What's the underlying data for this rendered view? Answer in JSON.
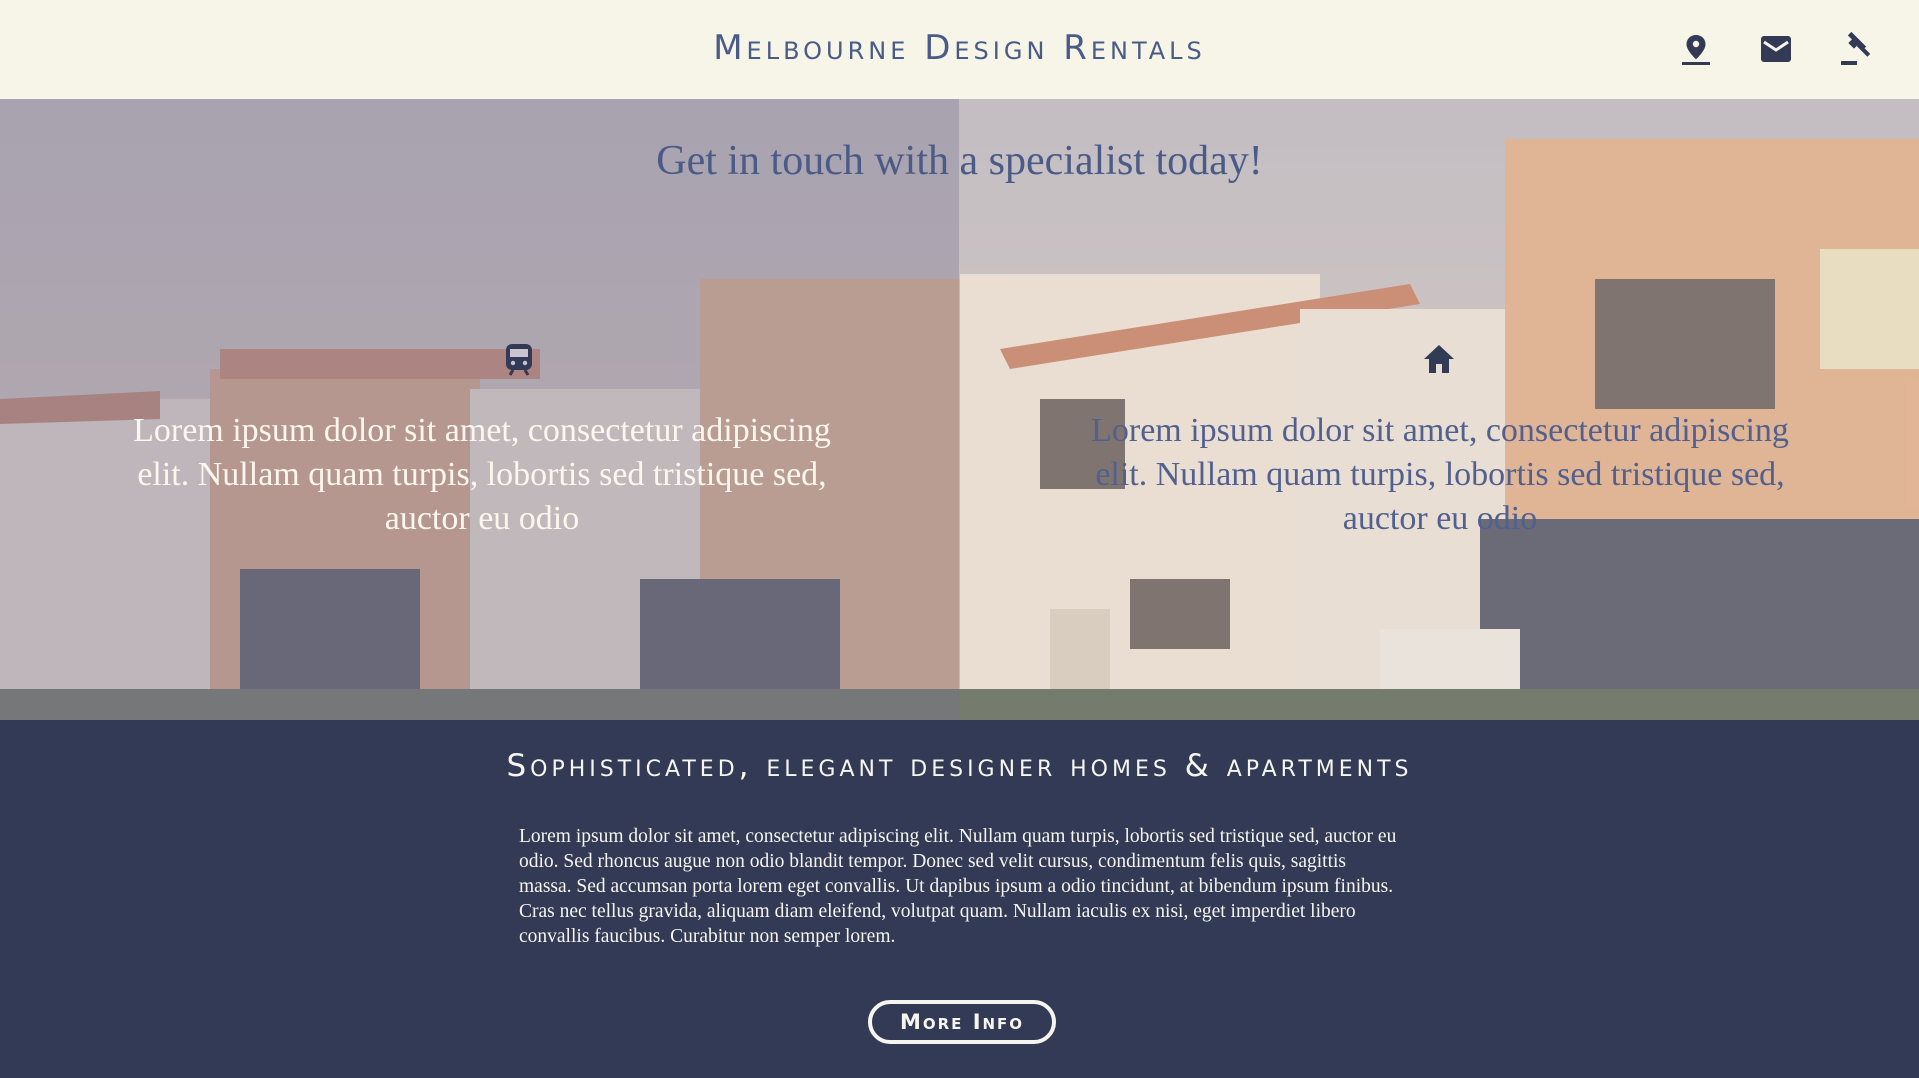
{
  "header": {
    "brand": "Melbourne Design Rentals",
    "icons": [
      "map-pin-icon",
      "mail-icon",
      "gavel-icon"
    ]
  },
  "hero": {
    "title": "Get in touch with a specialist today!",
    "columns": [
      {
        "icon": "train-icon",
        "text": "Lorem ipsum dolor sit amet, consectetur adipiscing elit. Nullam quam turpis, lobortis sed tristique sed, auctor eu odio"
      },
      {
        "icon": "home-icon",
        "text": "Lorem ipsum dolor sit amet, consectetur adipiscing elit. Nullam quam turpis, lobortis sed tristique sed, auctor eu odio"
      }
    ]
  },
  "info": {
    "title": "Sophisticated, elegant designer homes & apartments",
    "body": "Lorem ipsum dolor sit amet, consectetur adipiscing elit. Nullam quam turpis, lobortis sed tristique sed, auctor eu odio. Sed rhoncus augue non odio blandit tempor. Donec sed velit cursus, condimentum felis quis, sagittis massa. Sed accumsan porta lorem eget convallis. Ut dapibus ipsum a odio tincidunt, at bibendum ipsum finibus. Cras nec tellus gravida, aliquam diam eleifend, volutpat quam. Nullam iaculis ex nisi, eget imperdiet libero convallis faucibus. Curabitur non semper lorem.",
    "button": "More Info"
  },
  "colors": {
    "header_bg": "#f6f5e7",
    "brand": "#4a5b88",
    "navy": "#323a56",
    "cream": "#f6f5ee"
  }
}
